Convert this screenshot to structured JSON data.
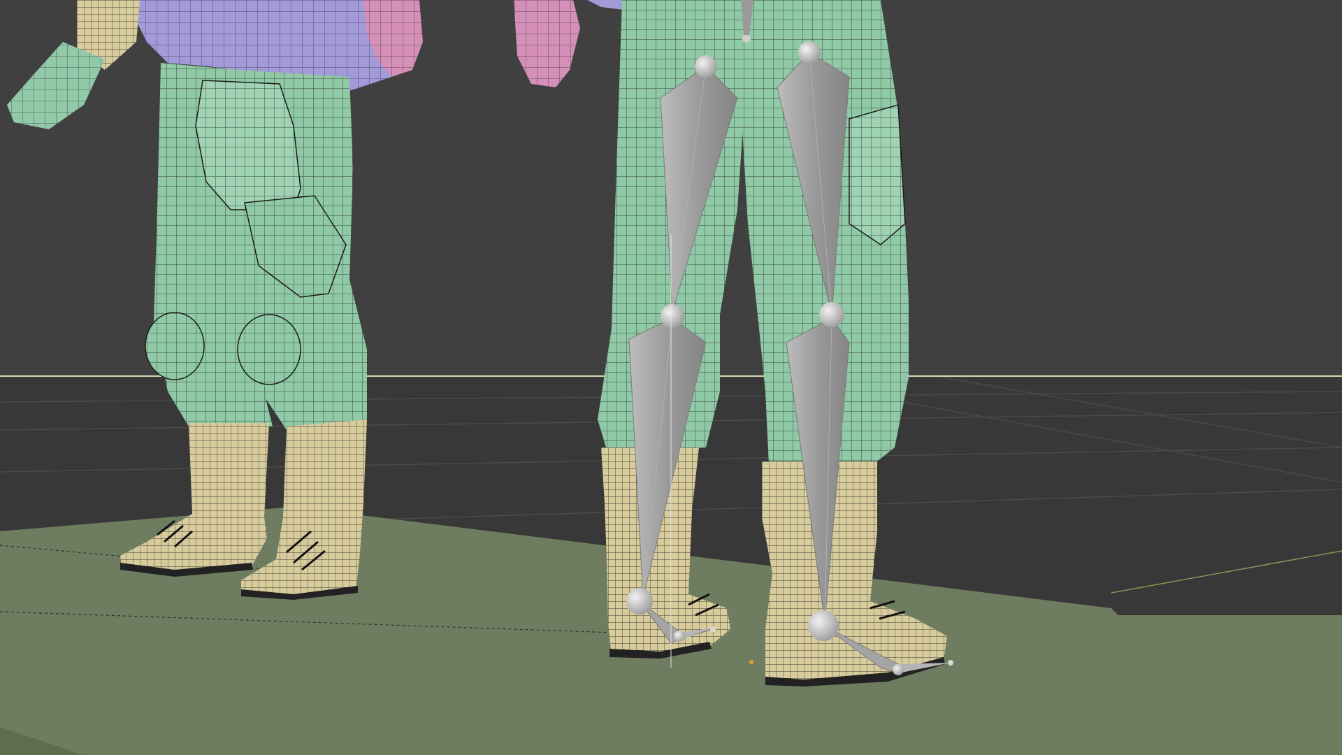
{
  "app": {
    "view": "3d-viewport",
    "mode": "pose",
    "shading": "solid-wireframe-overlay"
  },
  "scene": {
    "background_color": "#3e3e3e",
    "upper_bg_color": "#404040",
    "lower_bg_color": "#383838",
    "floor_color": "#6e7d5f",
    "floor_shadow_color": "#5f6d51",
    "horizon_color": "#d8d8b0",
    "grid_color": "#4a4a4a",
    "wire_color": "#1a1a1a",
    "pants_color": "#8fc9a6",
    "pants_shade_color": "#6fa88a",
    "boot_color": "#d8cc9c",
    "boot_shade_color": "#b7ab7e",
    "vest_color": "#a39ad9",
    "glove_left_color": "#92c9a8",
    "glove_pink_color": "#d490b8",
    "bone_color": "#9e9e9e",
    "bone_light_color": "#c3c3c3",
    "joint_color": "#dcdcdc",
    "cursor_color": "#e8e8e8",
    "origin_color": "#e3a52a"
  },
  "objects": [
    {
      "name": "character-left",
      "type": "mesh-icon"
    },
    {
      "name": "character-right",
      "type": "mesh-icon"
    },
    {
      "name": "leg-armature",
      "type": "armature-icon"
    }
  ]
}
